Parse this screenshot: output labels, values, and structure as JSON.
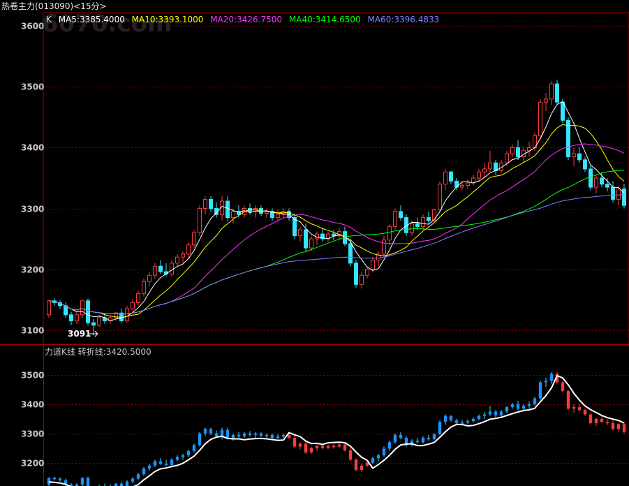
{
  "title": "热卷主力(013090)<15分>",
  "colors": {
    "up": "#ff3b3b",
    "down": "#33e6ff",
    "ma5": "#ffffff",
    "ma10": "#ffff00",
    "ma20": "#ff33ff",
    "ma40": "#00ff00",
    "ma60": "#8080ff",
    "grid": "#8b0000",
    "border": "#a00000",
    "turn": "#ffffff"
  },
  "chart_data": [
    {
      "type": "candlestick",
      "legend": [
        {
          "label": "K",
          "color": "#d8d8d8"
        },
        {
          "label": "MA5:3385.4000",
          "color": "#ffffff"
        },
        {
          "label": "MA10:3393.1000",
          "color": "#ffff00"
        },
        {
          "label": "MA20:3426.7500",
          "color": "#ff33ff"
        },
        {
          "label": "MA40:3414.6500",
          "color": "#00ff00"
        },
        {
          "label": "MA60:3396.4833",
          "color": "#8080ff"
        }
      ],
      "yticks": [
        3100,
        3200,
        3300,
        3400,
        3500,
        3600
      ],
      "ylim": [
        3080,
        3620
      ],
      "annotation": "3091",
      "candles": [
        [
          3125,
          3150,
          3120,
          3148
        ],
        [
          3148,
          3152,
          3140,
          3145
        ],
        [
          3145,
          3150,
          3135,
          3140
        ],
        [
          3140,
          3145,
          3120,
          3125
        ],
        [
          3125,
          3130,
          3108,
          3115
        ],
        [
          3115,
          3130,
          3110,
          3125
        ],
        [
          3125,
          3150,
          3120,
          3148
        ],
        [
          3148,
          3152,
          3108,
          3112
        ],
        [
          3112,
          3118,
          3091,
          3108
        ],
        [
          3108,
          3125,
          3105,
          3120
        ],
        [
          3120,
          3128,
          3110,
          3115
        ],
        [
          3115,
          3125,
          3110,
          3120
        ],
        [
          3120,
          3130,
          3115,
          3128
        ],
        [
          3128,
          3135,
          3112,
          3115
        ],
        [
          3115,
          3140,
          3112,
          3135
        ],
        [
          3135,
          3150,
          3130,
          3145
        ],
        [
          3145,
          3165,
          3140,
          3160
        ],
        [
          3160,
          3185,
          3155,
          3180
        ],
        [
          3180,
          3195,
          3172,
          3190
        ],
        [
          3190,
          3210,
          3185,
          3205
        ],
        [
          3205,
          3215,
          3192,
          3196
        ],
        [
          3196,
          3210,
          3188,
          3192
        ],
        [
          3192,
          3215,
          3188,
          3210
        ],
        [
          3210,
          3225,
          3205,
          3220
        ],
        [
          3220,
          3230,
          3210,
          3225
        ],
        [
          3225,
          3245,
          3218,
          3240
        ],
        [
          3240,
          3265,
          3235,
          3260
        ],
        [
          3260,
          3305,
          3255,
          3300
        ],
        [
          3300,
          3320,
          3290,
          3315
        ],
        [
          3315,
          3320,
          3295,
          3300
        ],
        [
          3300,
          3310,
          3285,
          3290
        ],
        [
          3290,
          3320,
          3280,
          3312
        ],
        [
          3312,
          3320,
          3280,
          3285
        ],
        [
          3285,
          3300,
          3275,
          3295
        ],
        [
          3295,
          3305,
          3285,
          3290
        ],
        [
          3290,
          3305,
          3285,
          3300
        ],
        [
          3300,
          3308,
          3290,
          3295
        ],
        [
          3295,
          3305,
          3285,
          3300
        ],
        [
          3300,
          3305,
          3288,
          3292
        ],
        [
          3292,
          3300,
          3285,
          3295
        ],
        [
          3295,
          3300,
          3280,
          3285
        ],
        [
          3285,
          3298,
          3280,
          3290
        ],
        [
          3290,
          3300,
          3285,
          3295
        ],
        [
          3295,
          3300,
          3280,
          3285
        ],
        [
          3285,
          3292,
          3250,
          3255
        ],
        [
          3255,
          3270,
          3245,
          3265
        ],
        [
          3265,
          3275,
          3230,
          3235
        ],
        [
          3235,
          3255,
          3230,
          3250
        ],
        [
          3250,
          3262,
          3240,
          3258
        ],
        [
          3258,
          3268,
          3245,
          3250
        ],
        [
          3250,
          3262,
          3245,
          3258
        ],
        [
          3258,
          3265,
          3248,
          3255
        ],
        [
          3255,
          3268,
          3250,
          3262
        ],
        [
          3262,
          3270,
          3238,
          3242
        ],
        [
          3242,
          3250,
          3205,
          3210
        ],
        [
          3210,
          3215,
          3170,
          3175
        ],
        [
          3175,
          3195,
          3168,
          3190
        ],
        [
          3190,
          3205,
          3185,
          3200
        ],
        [
          3200,
          3220,
          3195,
          3215
        ],
        [
          3215,
          3230,
          3205,
          3225
        ],
        [
          3225,
          3255,
          3220,
          3248
        ],
        [
          3248,
          3275,
          3240,
          3270
        ],
        [
          3270,
          3300,
          3265,
          3295
        ],
        [
          3295,
          3305,
          3280,
          3285
        ],
        [
          3285,
          3290,
          3255,
          3260
        ],
        [
          3260,
          3280,
          3255,
          3275
        ],
        [
          3275,
          3285,
          3265,
          3270
        ],
        [
          3270,
          3290,
          3265,
          3285
        ],
        [
          3285,
          3295,
          3275,
          3280
        ],
        [
          3280,
          3300,
          3278,
          3298
        ],
        [
          3298,
          3345,
          3295,
          3340
        ],
        [
          3340,
          3365,
          3330,
          3360
        ],
        [
          3360,
          3362,
          3340,
          3345
        ],
        [
          3345,
          3350,
          3330,
          3335
        ],
        [
          3335,
          3345,
          3330,
          3338
        ],
        [
          3338,
          3348,
          3332,
          3342
        ],
        [
          3342,
          3355,
          3338,
          3350
        ],
        [
          3350,
          3365,
          3345,
          3360
        ],
        [
          3360,
          3375,
          3350,
          3365
        ],
        [
          3365,
          3395,
          3360,
          3375
        ],
        [
          3375,
          3380,
          3355,
          3362
        ],
        [
          3362,
          3380,
          3358,
          3375
        ],
        [
          3375,
          3395,
          3370,
          3390
        ],
        [
          3390,
          3405,
          3385,
          3400
        ],
        [
          3400,
          3412,
          3380,
          3385
        ],
        [
          3385,
          3400,
          3375,
          3395
        ],
        [
          3395,
          3410,
          3385,
          3400
        ],
        [
          3400,
          3425,
          3395,
          3420
        ],
        [
          3420,
          3480,
          3415,
          3475
        ],
        [
          3475,
          3490,
          3460,
          3480
        ],
        [
          3480,
          3510,
          3470,
          3505
        ],
        [
          3505,
          3512,
          3470,
          3475
        ],
        [
          3475,
          3480,
          3440,
          3445
        ],
        [
          3445,
          3450,
          3380,
          3385
        ],
        [
          3385,
          3400,
          3370,
          3390
        ],
        [
          3390,
          3400,
          3375,
          3380
        ],
        [
          3380,
          3385,
          3360,
          3365
        ],
        [
          3365,
          3370,
          3330,
          3335
        ],
        [
          3335,
          3355,
          3325,
          3350
        ],
        [
          3350,
          3360,
          3335,
          3340
        ],
        [
          3340,
          3350,
          3328,
          3335
        ],
        [
          3335,
          3345,
          3310,
          3315
        ],
        [
          3315,
          3338,
          3305,
          3332
        ],
        [
          3332,
          3340,
          3300,
          3305
        ]
      ]
    },
    {
      "type": "line-k",
      "legend": [
        {
          "label": "力道K线  转折线:3420.5000",
          "color": "#c8c8c8"
        }
      ],
      "yticks": [
        3200,
        3300,
        3400,
        3500
      ],
      "ylim": [
        3120,
        3560
      ],
      "mode": [
        "down",
        "down",
        "down",
        "down",
        "down",
        "down",
        "down",
        "down",
        "down",
        "down",
        "down",
        "down",
        "down",
        "down",
        "down",
        "down",
        "down",
        "down",
        "down",
        "down",
        "down",
        "down",
        "down",
        "down",
        "down",
        "down",
        "down",
        "down",
        "down",
        "down",
        "down",
        "down",
        "down",
        "down",
        "down",
        "down",
        "down",
        "down",
        "down",
        "down",
        "down",
        "down",
        "down",
        "up",
        "up",
        "up",
        "up",
        "up",
        "up",
        "up",
        "up",
        "up",
        "up",
        "up",
        "up",
        "up",
        "up",
        "up",
        "down",
        "down",
        "down",
        "down",
        "down",
        "down",
        "down",
        "down",
        "down",
        "down",
        "down",
        "down",
        "down",
        "down",
        "down",
        "down",
        "down",
        "down",
        "down",
        "down",
        "down",
        "down",
        "down",
        "down",
        "down",
        "down",
        "down",
        "down",
        "down",
        "down",
        "down",
        "down",
        "down",
        "up",
        "up",
        "up",
        "up",
        "up",
        "up",
        "up",
        "up",
        "up",
        "up",
        "up",
        "up",
        "up"
      ]
    }
  ]
}
